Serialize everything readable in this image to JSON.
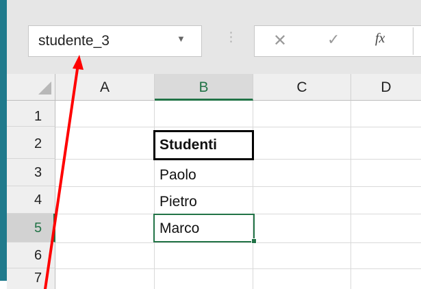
{
  "name_box": {
    "value": "studente_3",
    "dropdown_icon": "caret-down-icon"
  },
  "formula_bar": {
    "separator": "⋮",
    "cancel_icon": "✕",
    "enter_icon": "✓",
    "fx_label": "fx",
    "content": ""
  },
  "columns": [
    "A",
    "B",
    "C",
    "D"
  ],
  "selected_column": "B",
  "rows": [
    "1",
    "2",
    "3",
    "4",
    "5",
    "6",
    "7"
  ],
  "selected_row": "5",
  "cells": {
    "B2": "Studenti",
    "B3": "Paolo",
    "B4": "Pietro",
    "B5": "Marco"
  },
  "annotation": {
    "color": "#ff0000",
    "points_to": "name-box"
  },
  "colors": {
    "accent": "#217346",
    "window_edge": "#1f7a8c"
  }
}
